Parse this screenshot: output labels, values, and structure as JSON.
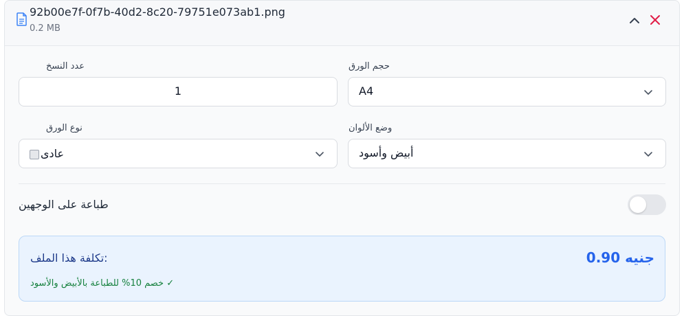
{
  "file": {
    "name": "92b00e7f-0f7b-40d2-8c20-79751e073ab1.png",
    "size": "0.2 MB",
    "icon": "file-text-icon",
    "collapse_icon": "chevron-up-icon",
    "remove_icon": "close-icon"
  },
  "fields": {
    "copies": {
      "label": "عدد النسخ",
      "value": "1"
    },
    "paper_size": {
      "label": "حجم الورق",
      "value": "A4"
    },
    "paper_type": {
      "label": "نوع الورق",
      "value": "عادى"
    },
    "color_mode": {
      "label": "وضع الألوان",
      "value": "أبيض وأسود"
    }
  },
  "duplex": {
    "label": "طباعة على الوجهين",
    "enabled": false
  },
  "cost": {
    "title": ":تكلفة هذا الملف",
    "amount": "جنيه 0.90",
    "discount": "خصم 10% للطباعة بالأبيض والأسود ✓"
  },
  "colors": {
    "accent": "#2563eb",
    "close": "#e11d48",
    "success": "#15803d",
    "cost_bg": "#eaf3fe"
  }
}
